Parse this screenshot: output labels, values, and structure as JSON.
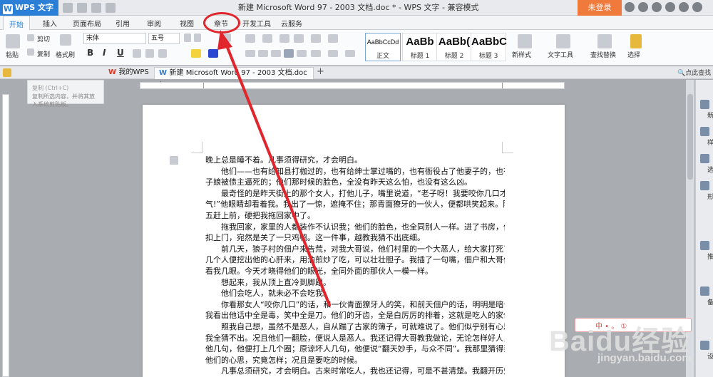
{
  "app": {
    "brand": "WPS 文字",
    "window_title": "新建 Microsoft Word 97 - 2003 文档.doc * - WPS 文字 - 兼容模式",
    "login": "未登录"
  },
  "menu_tabs": [
    "开始",
    "插入",
    "页面布局",
    "引用",
    "审阅",
    "视图",
    "章节",
    "开发工具",
    "云服务"
  ],
  "ribbon": {
    "paste": "粘贴",
    "cut": "剪切",
    "copy": "复制",
    "format_painter": "格式刷",
    "font_name": "宋体",
    "font_size": "五号",
    "bold": "B",
    "italic": "I",
    "underline": "U",
    "styles": [
      {
        "sample": "AaBbCcDd",
        "name": "正文"
      },
      {
        "sample": "AaBb",
        "name": "标题 1"
      },
      {
        "sample": "AaBb(",
        "name": "标题 2"
      },
      {
        "sample": "AaBbC",
        "name": "标题 3"
      }
    ],
    "new_style": "新样式",
    "text_tools": "文字工具",
    "find_replace": "查找替换",
    "select": "选择"
  },
  "doc_tabs": {
    "my_wps": "我的WPS",
    "active_doc": "新建 Microsoft Word 97 - 2003 文档.doc *",
    "search": "点此查找"
  },
  "tooltip": {
    "title": "复制 (Ctrl+C)",
    "desc": "复制所选内容，并将其放入系统剪贴板。"
  },
  "document": {
    "paragraphs": [
      {
        "indent": false,
        "text": "晚上总是睡不着。凡事须得研究，才会明白。"
      },
      {
        "indent": true,
        "text": "他们——也有给知县打枷过的，也有给绅士掌过嘴的，也有衙役占了他妻子的，也有老"
      },
      {
        "indent": false,
        "text": "子娘被债主逼死的；他们那时候的脸色，全没有昨天这么怕，也没有这么凶。"
      },
      {
        "indent": true,
        "text": "最奇怪的是昨天街上的那个女人，打他儿子，嘴里说道，“老子呀！我要咬你几口才出"
      },
      {
        "indent": false,
        "text": "气!”他眼睛却看着我。我出了一惊，遮掩不住；那青面獠牙的一伙人，便都哄笑起来。陈  老"
      },
      {
        "indent": false,
        "text": "五赶上前，硬把我拖回家中了。"
      },
      {
        "indent": true,
        "text": "拖我回家，家里的人都装作不认识我；他们的脸色，也全同别人一样。进了书房，便反"
      },
      {
        "indent": false,
        "text": "扣上门，宛然是关了一只鸡鸭。这一件事，越教我猜不出底细。"
      },
      {
        "indent": true,
        "text": "前几天，狼子村的佃户来告荒，对我大哥说，他们村里的一个大恶人，给大家打死了；"
      },
      {
        "indent": false,
        "text": "几个人便挖出他的心肝来，用油煎炒了吃，可以壮壮胆子。我插了一句嘴，佃户和大哥便都"
      },
      {
        "indent": false,
        "text": "看我几眼。今天才晓得他们的眼光，全同外面的那伙人一模一样。"
      },
      {
        "indent": true,
        "text": "想起来，我从顶上直冷到脚跟。"
      },
      {
        "indent": true,
        "text": "他们会吃人，就未必不会吃我。"
      },
      {
        "indent": true,
        "text": "你看那女人“咬你几口”的话，和一伙青面獠牙人的笑，和前天佃户的话，明明是暗号。"
      },
      {
        "indent": false,
        "text": "我看出他话中全是毒，笑中全是刀。他们的牙齿，全是白厉厉的排着，这就是吃人的家伙。"
      },
      {
        "indent": true,
        "text": "照我自己想，虽然不是恶人，自从踹了古家的簿子，可就难说了。他们似乎别有心思，"
      },
      {
        "indent": false,
        "text": "我全猜不出。况且他们一翻脸，便说人是恶人。我还记得大哥教我做论，无论怎样好人，翻"
      },
      {
        "indent": false,
        "text": "他几句，他便打上几个圈；原谅坏人几句，他便说“翻天妙手，与众不同”。我那里猜得到"
      },
      {
        "indent": false,
        "text": "他们的心思，究竟怎样；况且是要吃的时候。"
      },
      {
        "indent": true,
        "text": "凡事总须研究，才会明白。古来时常吃人，我也还记得，可是不甚清楚。我翻开历史一"
      }
    ]
  },
  "right_panel": [
    "新",
    "样",
    "选",
    "形",
    "推",
    "备",
    "设"
  ],
  "watermark": {
    "brand": "Baidu经验",
    "url": "jingyan.baidu.com",
    "strip": "中 • 。 ①"
  },
  "colors": {
    "accent": "#2c7fd6",
    "login": "#f07a3c",
    "annotation": "#e0262c"
  }
}
